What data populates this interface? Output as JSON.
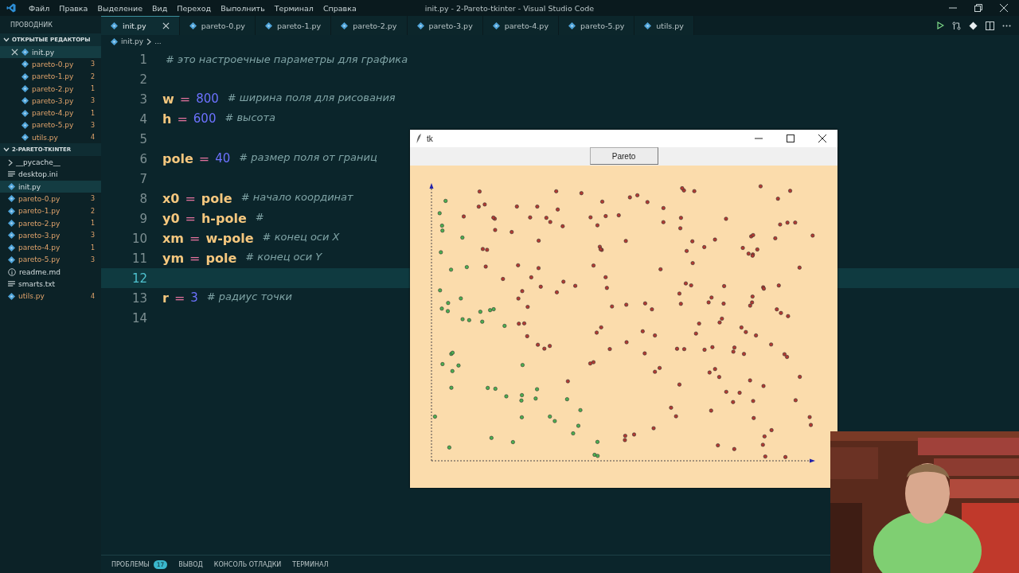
{
  "title_bar": {
    "menu": [
      "Файл",
      "Правка",
      "Выделение",
      "Вид",
      "Переход",
      "Выполнить",
      "Терминал",
      "Справка"
    ],
    "title": "init.py - 2-Pareto-tkinter - Visual Studio Code"
  },
  "sidebar": {
    "title": "ПРОВОДНИК",
    "open_editors": {
      "title": "ОТКРЫТЫЕ РЕДАКТОРЫ",
      "items": [
        {
          "name": "init.py",
          "kind": "python",
          "selected": true
        },
        {
          "name": "pareto-0.py",
          "kind": "python",
          "count": "3",
          "selected": false
        },
        {
          "name": "pareto-1.py",
          "kind": "python",
          "count": "2",
          "selected": false
        },
        {
          "name": "pareto-2.py",
          "kind": "python",
          "count": "1",
          "selected": false
        },
        {
          "name": "pareto-3.py",
          "kind": "python",
          "count": "3",
          "selected": false
        },
        {
          "name": "pareto-4.py",
          "kind": "python",
          "count": "1",
          "selected": false
        },
        {
          "name": "pareto-5.py",
          "kind": "python",
          "count": "3",
          "selected": false
        },
        {
          "name": "utils.py",
          "kind": "python",
          "count": "4",
          "selected": false
        }
      ]
    },
    "folder": {
      "title": "2-PARETO-TKINTER",
      "items": [
        {
          "name": "__pycache__",
          "kind": "folder",
          "selected": false
        },
        {
          "name": "desktop.ini",
          "kind": "text",
          "selected": false
        },
        {
          "name": "init.py",
          "kind": "python",
          "selected": true
        },
        {
          "name": "pareto-0.py",
          "kind": "python",
          "count": "3",
          "selected": false
        },
        {
          "name": "pareto-1.py",
          "kind": "python",
          "count": "2",
          "selected": false
        },
        {
          "name": "pareto-2.py",
          "kind": "python",
          "count": "1",
          "selected": false
        },
        {
          "name": "pareto-3.py",
          "kind": "python",
          "count": "3",
          "selected": false
        },
        {
          "name": "pareto-4.py",
          "kind": "python",
          "count": "1",
          "selected": false
        },
        {
          "name": "pareto-5.py",
          "kind": "python",
          "count": "3",
          "selected": false
        },
        {
          "name": "readme.md",
          "kind": "info",
          "selected": false
        },
        {
          "name": "smarts.txt",
          "kind": "text",
          "selected": false
        },
        {
          "name": "utils.py",
          "kind": "python",
          "count": "4",
          "selected": false
        }
      ]
    }
  },
  "tabs": [
    {
      "label": "init.py",
      "selected": true
    },
    {
      "label": "pareto-0.py",
      "selected": false
    },
    {
      "label": "pareto-1.py",
      "selected": false
    },
    {
      "label": "pareto-2.py",
      "selected": false
    },
    {
      "label": "pareto-3.py",
      "selected": false
    },
    {
      "label": "pareto-4.py",
      "selected": false
    },
    {
      "label": "pareto-5.py",
      "selected": false
    },
    {
      "label": "utils.py",
      "selected": false
    }
  ],
  "breadcrumb": [
    "init.py",
    "..."
  ],
  "editor": {
    "lines": [
      {
        "number": "1",
        "active": false,
        "tokens": [
          {
            "kind": "comment",
            "text": "# это настроечные параметры для графика"
          }
        ]
      },
      {
        "number": "2",
        "active": false
      },
      {
        "number": "3",
        "active": false,
        "tokens": [
          {
            "kind": "name",
            "text": "w"
          },
          {
            "kind": "op",
            "text": "="
          },
          {
            "kind": "number",
            "text": "800"
          },
          {
            "kind": "comment",
            "text": "# ширина поля для рисования"
          }
        ]
      },
      {
        "number": "4",
        "active": false,
        "tokens": [
          {
            "kind": "name",
            "text": "h"
          },
          {
            "kind": "op",
            "text": "="
          },
          {
            "kind": "number",
            "text": "600"
          },
          {
            "kind": "comment",
            "text": "# высота"
          }
        ]
      },
      {
        "number": "5",
        "active": false
      },
      {
        "number": "6",
        "active": false,
        "tokens": [
          {
            "kind": "name",
            "text": "pole"
          },
          {
            "kind": "op",
            "text": "="
          },
          {
            "kind": "number",
            "text": "40"
          },
          {
            "kind": "comment",
            "text": "# размер поля от границ"
          }
        ]
      },
      {
        "number": "7",
        "active": false
      },
      {
        "number": "8",
        "active": false,
        "tokens": [
          {
            "kind": "name",
            "text": "x0"
          },
          {
            "kind": "op",
            "text": "="
          },
          {
            "kind": "name",
            "text": "pole"
          },
          {
            "kind": "comment",
            "text": "# начало координат"
          }
        ]
      },
      {
        "number": "9",
        "active": false,
        "tokens": [
          {
            "kind": "name",
            "text": "y0"
          },
          {
            "kind": "op",
            "text": "="
          },
          {
            "kind": "name",
            "text": "h-pole"
          },
          {
            "kind": "comment",
            "text": "#"
          }
        ]
      },
      {
        "number": "10",
        "active": false,
        "tokens": [
          {
            "kind": "name",
            "text": "xm"
          },
          {
            "kind": "op",
            "text": "="
          },
          {
            "kind": "name",
            "text": "w-pole"
          },
          {
            "kind": "comment",
            "text": "# конец оси X"
          }
        ]
      },
      {
        "number": "11",
        "active": false,
        "tokens": [
          {
            "kind": "name",
            "text": "ym"
          },
          {
            "kind": "op",
            "text": "="
          },
          {
            "kind": "name",
            "text": "pole"
          },
          {
            "kind": "comment",
            "text": "# конец оси Y"
          }
        ]
      },
      {
        "number": "12",
        "active": true
      },
      {
        "number": "13",
        "active": false,
        "tokens": [
          {
            "kind": "name",
            "text": "r"
          },
          {
            "kind": "op",
            "text": "="
          },
          {
            "kind": "number",
            "text": "3"
          },
          {
            "kind": "comment",
            "text": "# радиус точки"
          }
        ]
      },
      {
        "number": "14",
        "active": false
      }
    ]
  },
  "panel_tabs": [
    {
      "label": "ПРОБЛЕМЫ",
      "badge": "17"
    },
    {
      "label": "ВЫВОД"
    },
    {
      "label": "КОНСОЛЬ ОТЛАДКИ"
    },
    {
      "label": "ТЕРМИНАЛ"
    }
  ],
  "tk_window": {
    "title": "tk",
    "button": "Pareto"
  }
}
